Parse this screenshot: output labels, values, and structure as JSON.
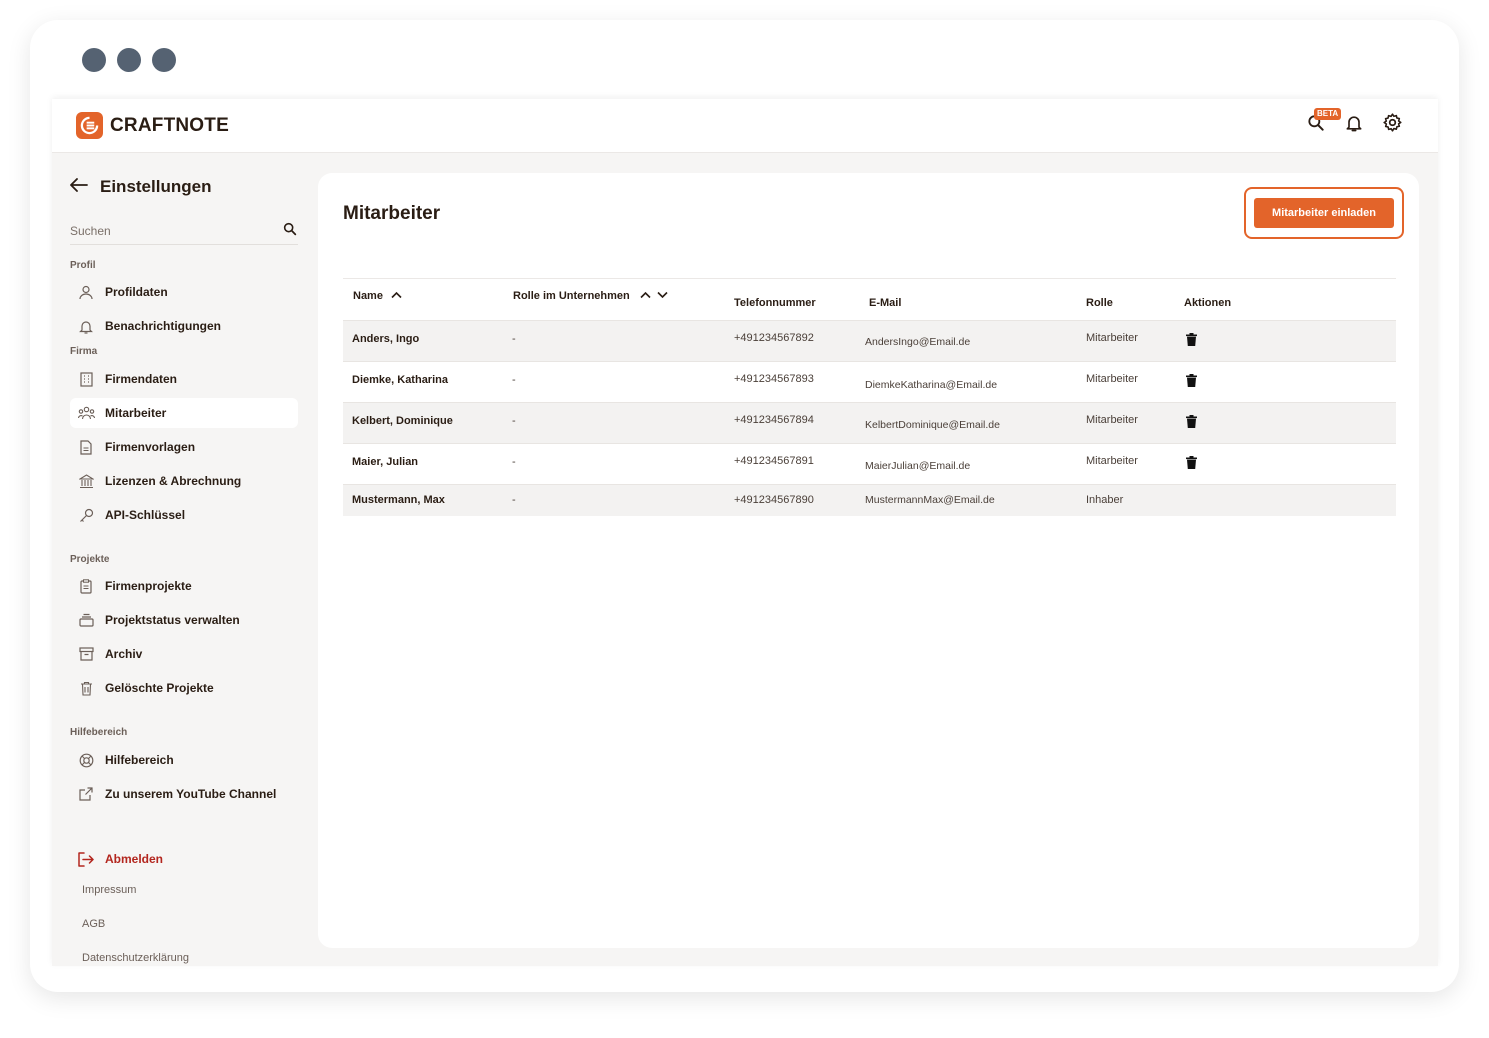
{
  "header": {
    "brand": "CRAFTNOTE",
    "search_badge": "BETA",
    "icons": [
      "search-icon",
      "bell-icon",
      "gear-icon"
    ]
  },
  "sidebar": {
    "back_label": "Einstellungen",
    "search_placeholder": "Suchen",
    "sections": {
      "profil": "Profil",
      "firma": "Firma",
      "projekte": "Projekte",
      "hilfe": "Hilfebereich"
    },
    "items": {
      "profildaten": "Profildaten",
      "benachrichtigungen": "Benachrichtigungen",
      "firmendaten": "Firmendaten",
      "mitarbeiter": "Mitarbeiter",
      "firmenvorlagen": "Firmenvorlagen",
      "lizenzen": "Lizenzen & Abrechnung",
      "api": "API-Schlüssel",
      "firmenprojekte": "Firmenprojekte",
      "projektstatus": "Projektstatus verwalten",
      "archiv": "Archiv",
      "geloeschte": "Gelöschte Projekte",
      "hilfebereich": "Hilfebereich",
      "youtube": "Zu unserem YouTube Channel"
    },
    "logout": "Abmelden",
    "footer": {
      "impressum": "Impressum",
      "agb": "AGB",
      "datenschutz": "Datenschutzerklärung"
    },
    "active_item": "Mitarbeiter"
  },
  "main": {
    "title": "Mitarbeiter",
    "invite_button": "Mitarbeiter einladen",
    "columns": {
      "name": "Name",
      "rolle_unternehmen": "Rolle im Unternehmen",
      "telefon": "Telefonnummer",
      "email": "E-Mail",
      "rolle": "Rolle",
      "aktionen": "Aktionen"
    },
    "rows": [
      {
        "name": "Anders, Ingo",
        "rolle_unternehmen": "-",
        "telefon": "+491234567892",
        "email": "AndersIngo@Email.de",
        "rolle": "Mitarbeiter"
      },
      {
        "name": "Diemke, Katharina",
        "rolle_unternehmen": "-",
        "telefon": "+491234567893",
        "email": "DiemkeKatharina@Email.de",
        "rolle": "Mitarbeiter"
      },
      {
        "name": "Kelbert, Dominique",
        "rolle_unternehmen": "-",
        "telefon": "+491234567894",
        "email": "KelbertDominique@Email.de",
        "rolle": "Mitarbeiter"
      },
      {
        "name": "Maier, Julian",
        "rolle_unternehmen": "-",
        "telefon": "+491234567891",
        "email": "MaierJulian@Email.de",
        "rolle": "Mitarbeiter"
      },
      {
        "name": "Mustermann, Max",
        "rolle_unternehmen": "-",
        "telefon": "+491234567890",
        "email": "MustermannMax@Email.de",
        "rolle": "Inhaber"
      }
    ]
  },
  "colors": {
    "accent": "#e3642a",
    "logout": "#b3261e",
    "text": "#2a1d14"
  }
}
